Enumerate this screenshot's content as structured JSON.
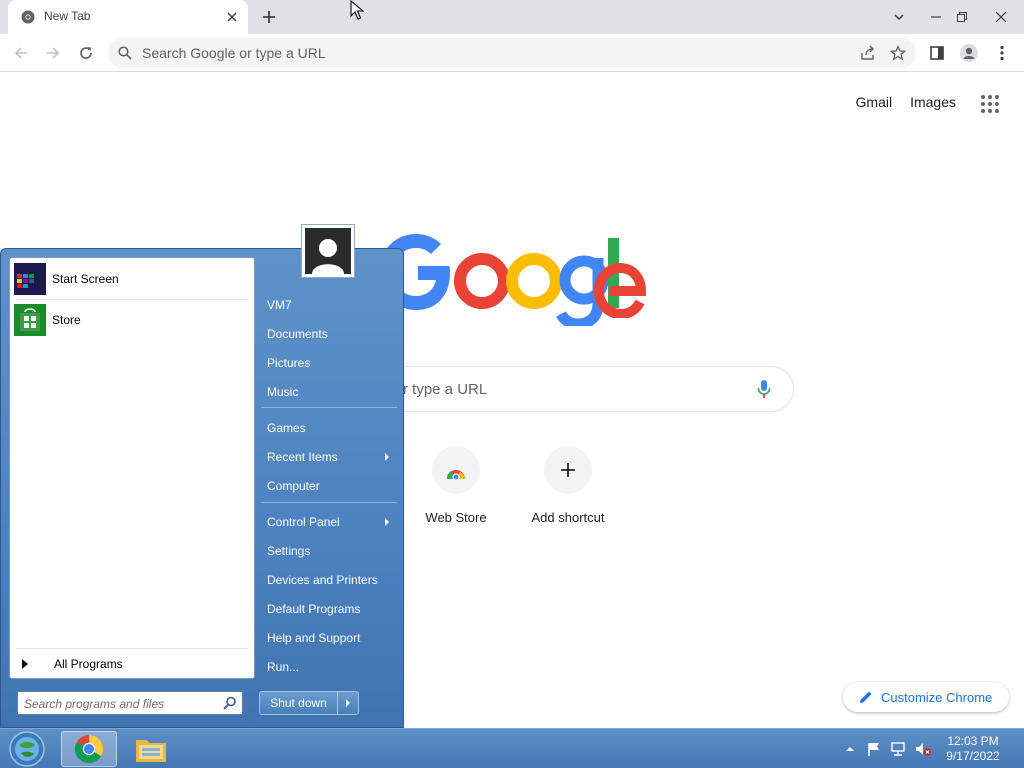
{
  "browser": {
    "tab_title": "New Tab",
    "omnibox_placeholder": "Search Google or type a URL"
  },
  "ntp": {
    "links": [
      "Gmail",
      "Images"
    ],
    "search_placeholder_visible": "r type a URL",
    "shortcuts": [
      {
        "label": "Web Store",
        "icon": "webstore-icon"
      },
      {
        "label": "Add shortcut",
        "icon": "plus-icon"
      }
    ],
    "customize_label": "Customize Chrome"
  },
  "start_menu": {
    "pinned": [
      {
        "label": "Start Screen",
        "icon": "start-screen-icon"
      },
      {
        "label": "Store",
        "icon": "store-icon"
      }
    ],
    "all_programs": "All Programs",
    "search_placeholder": "Search programs and files",
    "user_name": "VM7",
    "right_links": [
      {
        "label": "Documents",
        "submenu": false
      },
      {
        "label": "Pictures",
        "submenu": false
      },
      {
        "label": "Music",
        "submenu": false
      },
      {
        "label": "Games",
        "submenu": false
      },
      {
        "label": "Recent Items",
        "submenu": true
      },
      {
        "label": "Computer",
        "submenu": false
      },
      {
        "label": "Control Panel",
        "submenu": true
      },
      {
        "label": "Settings",
        "submenu": false
      },
      {
        "label": "Devices and Printers",
        "submenu": false
      },
      {
        "label": "Default Programs",
        "submenu": false
      },
      {
        "label": "Help and Support",
        "submenu": false
      },
      {
        "label": "Run...",
        "submenu": false
      }
    ],
    "shutdown_label": "Shut down"
  },
  "taskbar": {
    "apps": [
      "chrome-icon",
      "file-explorer-icon"
    ],
    "time": "12:03 PM",
    "date": "9/17/2022"
  },
  "colors": {
    "chrome_blue": "#1a73e8",
    "startmenu_blue": "#4c82bf",
    "taskbar_blue": "#4577b4"
  }
}
